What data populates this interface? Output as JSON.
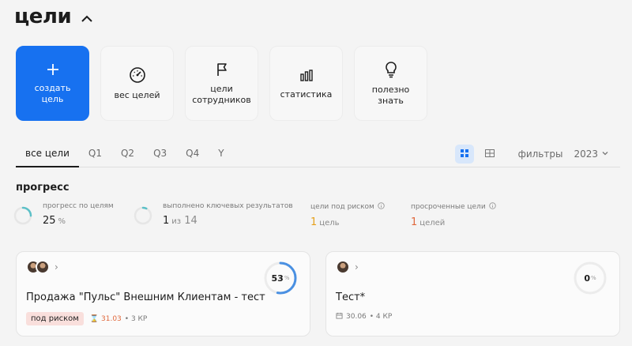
{
  "header": {
    "title": "цели"
  },
  "tiles": [
    {
      "label": "создать цель",
      "icon": "plus-icon"
    },
    {
      "label": "вес целей",
      "icon": "gauge-icon"
    },
    {
      "label": "цели сотрудников",
      "icon": "flag-icon"
    },
    {
      "label": "статистика",
      "icon": "bar-chart-icon"
    },
    {
      "label": "полезно знать",
      "icon": "lightbulb-icon"
    }
  ],
  "tabs": [
    "все цели",
    "Q1",
    "Q2",
    "Q3",
    "Q4",
    "Y"
  ],
  "filters_label": "фильтры",
  "year": "2023",
  "progress": {
    "title": "прогресс",
    "stats": [
      {
        "label": "прогресс по целям",
        "value": "25",
        "unit": "%",
        "fraction": 0.25
      },
      {
        "label": "выполнено ключевых результатов",
        "value": "1",
        "unit": "из",
        "total": "14",
        "fraction": 0.07
      },
      {
        "label": "цели под риском",
        "value": "1",
        "unit": "цель"
      },
      {
        "label": "просроченные цели",
        "value": "1",
        "unit": "целей"
      }
    ]
  },
  "cards": [
    {
      "title": "Продажа \"Пульс\" Внешним Клиентам - тест",
      "badge": "под риском",
      "date": "31.03",
      "kr": "• 3 КР",
      "progress": "53",
      "pct": "%",
      "fraction": 0.53
    },
    {
      "title": "Тест*",
      "date": "30.06",
      "kr": "• 4 КР",
      "progress": "0",
      "pct": "%",
      "fraction": 0
    }
  ],
  "colors": {
    "accent": "#1771f0",
    "ring": "#4a90e2",
    "risk": "#e6a11b",
    "overdue": "#e0683c"
  }
}
